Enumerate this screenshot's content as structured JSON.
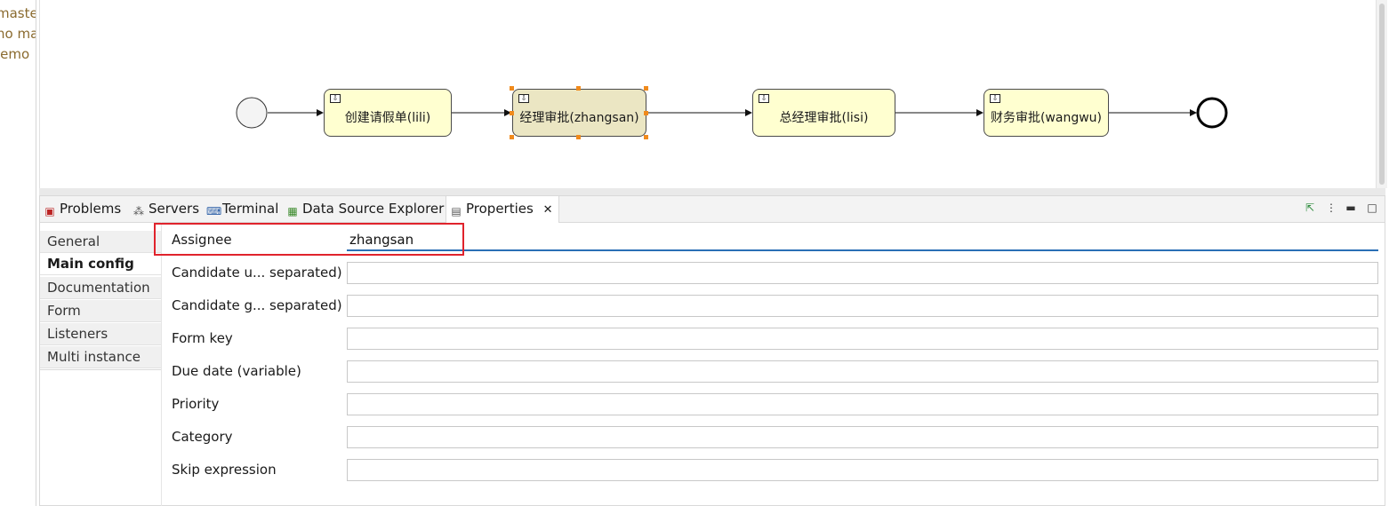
{
  "explorer": {
    "items": [
      "maste",
      "no ma",
      "lemo"
    ]
  },
  "diagram": {
    "tasks": [
      {
        "label": "创建请假单(lili)"
      },
      {
        "label": "经理审批(zhangsan)"
      },
      {
        "label": "总经理审批(lisi)"
      },
      {
        "label": "财务审批(wangwu)"
      }
    ],
    "selected_color": "#ebe6c3",
    "task_color": "#ffffd0",
    "selection_handle_color": "#f08a1c"
  },
  "views": {
    "tabs": [
      {
        "label": "Problems",
        "icon": "problems-icon"
      },
      {
        "label": "Servers",
        "icon": "servers-icon"
      },
      {
        "label": "Terminal",
        "icon": "terminal-icon"
      },
      {
        "label": "Data Source Explorer",
        "icon": "data-source-icon"
      },
      {
        "label": "Properties",
        "icon": "properties-icon",
        "active": true
      }
    ],
    "close_glyph": "✕"
  },
  "properties": {
    "sections": [
      "General",
      "Main config",
      "Documentation",
      "Form",
      "Listeners",
      "Multi instance"
    ],
    "active_section": "Main config",
    "fields": [
      {
        "label": "Assignee",
        "value": "zhangsan"
      },
      {
        "label": "Candidate u... separated)",
        "value": ""
      },
      {
        "label": "Candidate g... separated)",
        "value": ""
      },
      {
        "label": "Form key",
        "value": ""
      },
      {
        "label": "Due date (variable)",
        "value": ""
      },
      {
        "label": "Priority",
        "value": ""
      },
      {
        "label": "Category",
        "value": ""
      },
      {
        "label": "Skip expression",
        "value": ""
      }
    ],
    "highlight_color": "#e0232c",
    "focus_color": "#2a6fb5"
  }
}
